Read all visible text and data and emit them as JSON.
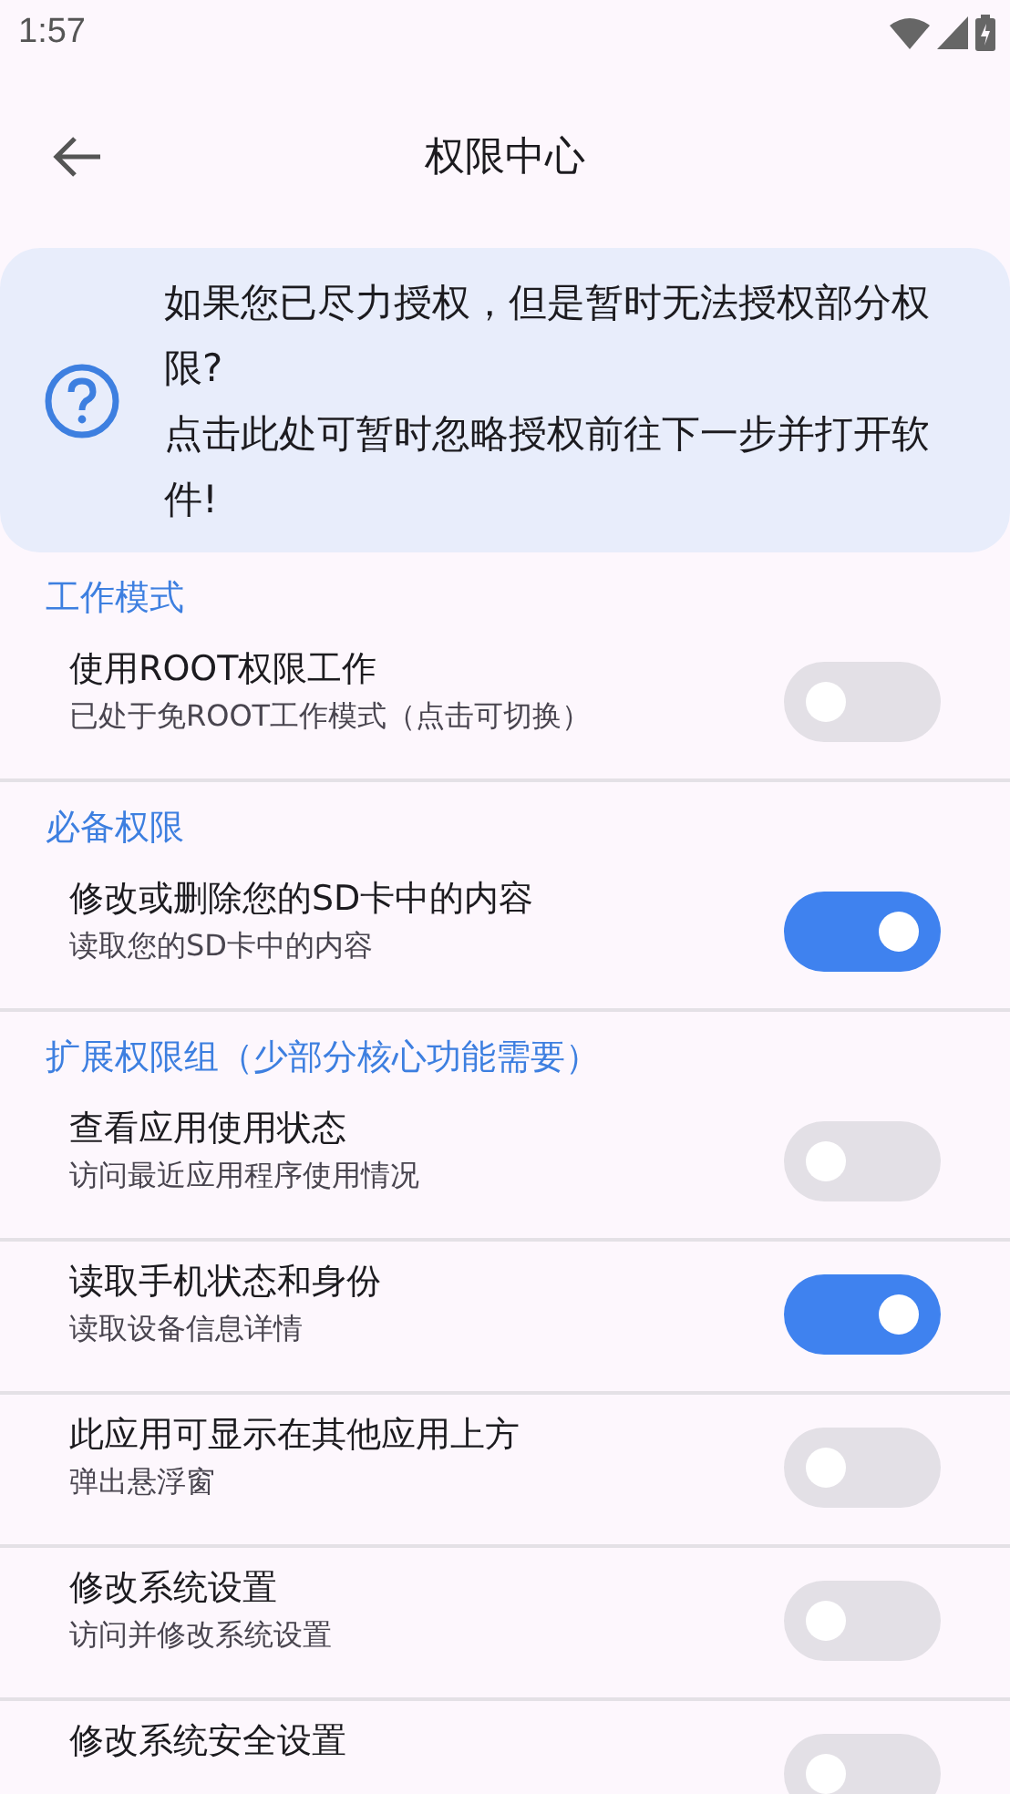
{
  "status_bar": {
    "time": "1:57"
  },
  "app_bar": {
    "title": "权限中心"
  },
  "notice": {
    "text": "如果您已尽力授权，但是暂时无法授权部分权限?\n点击此处可暂时忽略授权前往下一步并打开软件!"
  },
  "sections": [
    {
      "title": "工作模式",
      "items": [
        {
          "title": "使用ROOT权限工作",
          "subtitle": "已处于免ROOT工作模式（点击可切换）",
          "on": false
        }
      ]
    },
    {
      "title": "必备权限",
      "items": [
        {
          "title": "修改或删除您的SD卡中的内容",
          "subtitle": "读取您的SD卡中的内容",
          "on": true
        }
      ]
    },
    {
      "title": "扩展权限组（少部分核心功能需要）",
      "items": [
        {
          "title": "查看应用使用状态",
          "subtitle": "访问最近应用程序使用情况",
          "on": false
        },
        {
          "title": "读取手机状态和身份",
          "subtitle": "读取设备信息详情",
          "on": true
        },
        {
          "title": "此应用可显示在其他应用上方",
          "subtitle": "弹出悬浮窗",
          "on": false
        },
        {
          "title": "修改系统设置",
          "subtitle": "访问并修改系统设置",
          "on": false
        },
        {
          "title": "修改系统安全设置",
          "on": false
        }
      ]
    }
  ]
}
